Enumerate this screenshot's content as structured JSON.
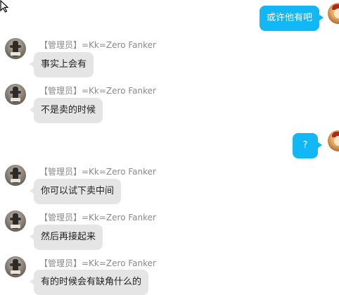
{
  "colors": {
    "outgoing_bubble": "#12b7f5",
    "incoming_bubble": "#e5e5e5",
    "sender_text": "#8a8a8a"
  },
  "messages": [
    {
      "direction": "outgoing",
      "text": "或许他有吧"
    },
    {
      "direction": "incoming",
      "sender": "【管理员】=Kk=Zero Fanker",
      "text": "事实上会有"
    },
    {
      "direction": "incoming",
      "sender": "【管理员】=Kk=Zero Fanker",
      "text": "不是卖的时候"
    },
    {
      "direction": "outgoing",
      "text": "?"
    },
    {
      "direction": "incoming",
      "sender": "【管理员】=Kk=Zero Fanker",
      "text": "你可以试下卖中间"
    },
    {
      "direction": "incoming",
      "sender": "【管理员】=Kk=Zero Fanker",
      "text": "然后再接起来"
    },
    {
      "direction": "incoming",
      "sender": "【管理员】=Kk=Zero Fanker",
      "text": "有的时候会有缺角什么的"
    }
  ]
}
